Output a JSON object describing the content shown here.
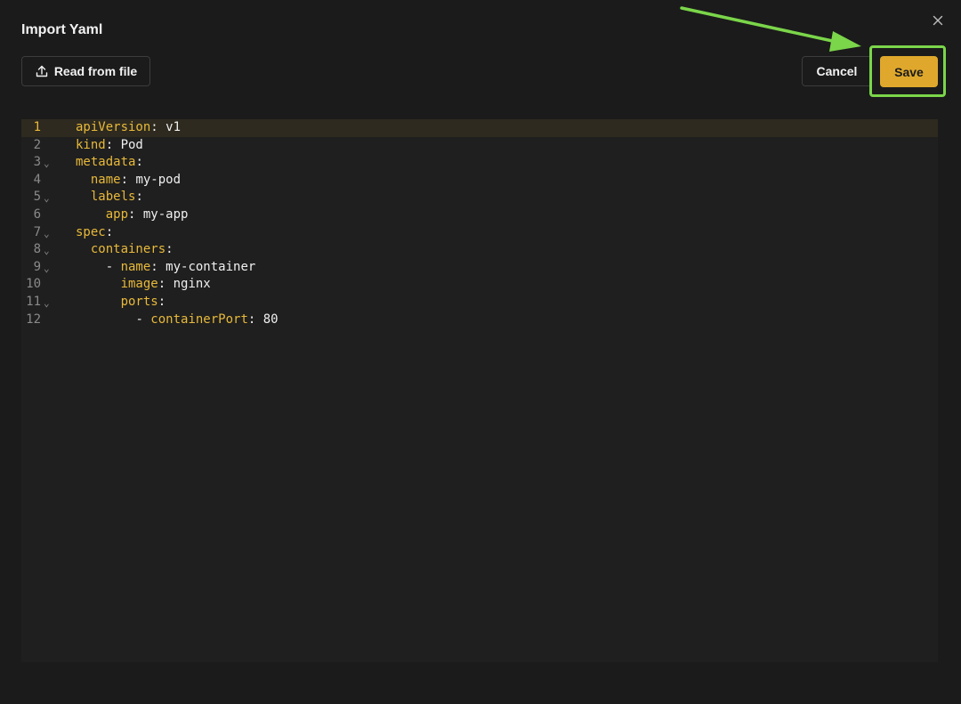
{
  "dialog": {
    "title": "Import Yaml",
    "read_from_file_label": "Read from file",
    "cancel_label": "Cancel",
    "save_label": "Save"
  },
  "colors": {
    "background": "#1b1b1b",
    "accent": "#dfa82c",
    "annotation": "#7bd64a",
    "key": "#e8b93a"
  },
  "icons": {
    "upload": "upload-icon",
    "close": "close-icon",
    "fold": "chevron-down-icon"
  },
  "editor": {
    "active_line": 1,
    "lines": [
      {
        "num": "1",
        "fold": false,
        "indent": "",
        "dash": "",
        "key": "apiVersion",
        "value": "v1"
      },
      {
        "num": "2",
        "fold": false,
        "indent": "",
        "dash": "",
        "key": "kind",
        "value": "Pod"
      },
      {
        "num": "3",
        "fold": true,
        "indent": "",
        "dash": "",
        "key": "metadata",
        "value": ""
      },
      {
        "num": "4",
        "fold": false,
        "indent": "  ",
        "dash": "",
        "key": "name",
        "value": "my-pod"
      },
      {
        "num": "5",
        "fold": true,
        "indent": "  ",
        "dash": "",
        "key": "labels",
        "value": ""
      },
      {
        "num": "6",
        "fold": false,
        "indent": "    ",
        "dash": "",
        "key": "app",
        "value": "my-app"
      },
      {
        "num": "7",
        "fold": true,
        "indent": "",
        "dash": "",
        "key": "spec",
        "value": ""
      },
      {
        "num": "8",
        "fold": true,
        "indent": "  ",
        "dash": "",
        "key": "containers",
        "value": ""
      },
      {
        "num": "9",
        "fold": true,
        "indent": "    ",
        "dash": "- ",
        "key": "name",
        "value": "my-container"
      },
      {
        "num": "10",
        "fold": false,
        "indent": "      ",
        "dash": "",
        "key": "image",
        "value": "nginx"
      },
      {
        "num": "11",
        "fold": true,
        "indent": "      ",
        "dash": "",
        "key": "ports",
        "value": ""
      },
      {
        "num": "12",
        "fold": false,
        "indent": "        ",
        "dash": "- ",
        "key": "containerPort",
        "value": "80"
      }
    ]
  }
}
